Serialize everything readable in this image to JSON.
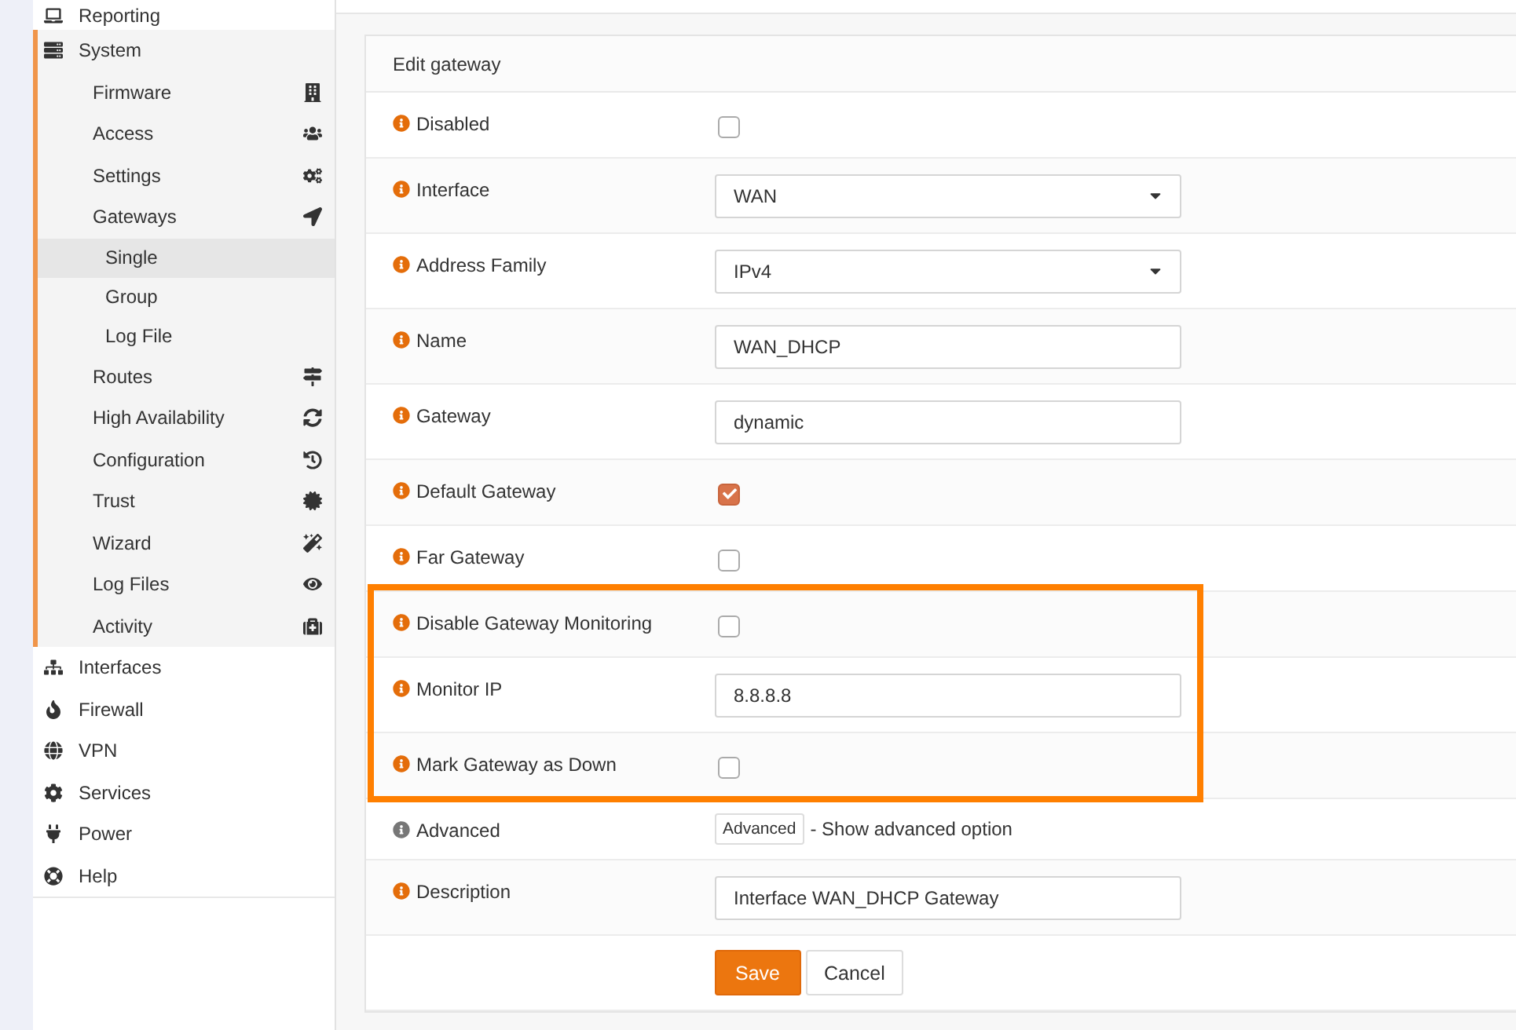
{
  "sidebar": {
    "items": [
      {
        "label": "Reporting",
        "expanded": false
      },
      {
        "label": "System",
        "expanded": true,
        "children": [
          {
            "label": "Firmware"
          },
          {
            "label": "Access"
          },
          {
            "label": "Settings"
          },
          {
            "label": "Gateways",
            "expanded": true,
            "children": [
              {
                "label": "Single",
                "selected": true
              },
              {
                "label": "Group",
                "selected": false
              },
              {
                "label": "Log File",
                "selected": false
              }
            ]
          },
          {
            "label": "Routes"
          },
          {
            "label": "High Availability"
          },
          {
            "label": "Configuration"
          },
          {
            "label": "Trust"
          },
          {
            "label": "Wizard"
          },
          {
            "label": "Log Files"
          },
          {
            "label": "Activity"
          }
        ]
      },
      {
        "label": "Interfaces",
        "expanded": false
      },
      {
        "label": "Firewall",
        "expanded": false
      },
      {
        "label": "VPN",
        "expanded": false
      },
      {
        "label": "Services",
        "expanded": false
      },
      {
        "label": "Power",
        "expanded": false
      },
      {
        "label": "Help",
        "expanded": false
      }
    ]
  },
  "form": {
    "title": "Edit gateway",
    "fields": [
      {
        "kind": "checkbox",
        "label": "Disabled",
        "has_help": true,
        "checked": false,
        "highlighted": false
      },
      {
        "kind": "select",
        "label": "Interface",
        "has_help": true,
        "value": "WAN",
        "highlighted": false
      },
      {
        "kind": "select",
        "label": "Address Family",
        "has_help": true,
        "value": "IPv4",
        "highlighted": false
      },
      {
        "kind": "text",
        "label": "Name",
        "has_help": true,
        "value": "WAN_DHCP",
        "highlighted": false
      },
      {
        "kind": "text",
        "label": "Gateway",
        "has_help": true,
        "value": "dynamic",
        "highlighted": false
      },
      {
        "kind": "checkbox",
        "label": "Default Gateway",
        "has_help": true,
        "checked": true,
        "highlighted": false
      },
      {
        "kind": "checkbox",
        "label": "Far Gateway",
        "has_help": true,
        "checked": false,
        "highlighted": false
      },
      {
        "kind": "checkbox",
        "label": "Disable Gateway Monitoring",
        "has_help": true,
        "checked": false,
        "highlighted": true
      },
      {
        "kind": "text",
        "label": "Monitor IP",
        "has_help": true,
        "value": "8.8.8.8",
        "highlighted": true
      },
      {
        "kind": "checkbox",
        "label": "Mark Gateway as Down",
        "has_help": true,
        "checked": false,
        "highlighted": true
      },
      {
        "kind": "toggle_button",
        "label": "Advanced",
        "has_help": false,
        "button": "Advanced",
        "note": "- Show advanced option",
        "highlighted": false
      },
      {
        "kind": "text",
        "label": "Description",
        "has_help": true,
        "value": "Interface WAN_DHCP Gateway",
        "highlighted": false
      }
    ],
    "buttons": [
      {
        "label": "Save",
        "primary": true
      },
      {
        "label": "Cancel",
        "primary": false
      }
    ]
  }
}
